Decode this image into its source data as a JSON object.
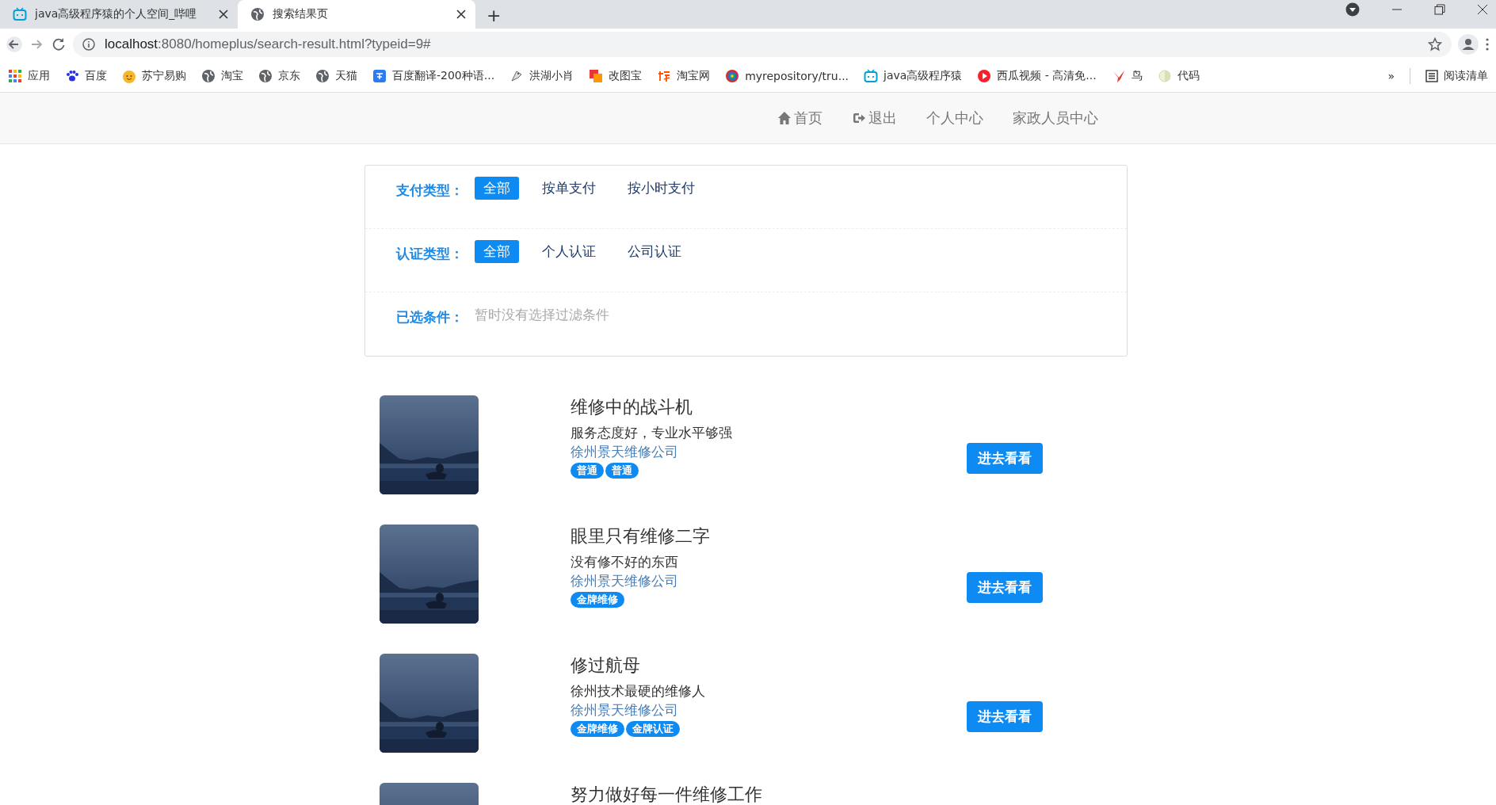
{
  "browser": {
    "tabs": [
      {
        "title": "java高级程序猿的个人空间_哔哩",
        "selected": false,
        "kind": "tv"
      },
      {
        "title": "搜索结果页",
        "selected": true,
        "kind": "globe"
      }
    ],
    "new_tab": "+",
    "url": {
      "host": "localhost",
      "rest": ":8080/homeplus/search-result.html?typeid=9#"
    },
    "bookmarks": [
      {
        "label": "应用",
        "kind": "grid"
      },
      {
        "label": "百度",
        "kind": "paw"
      },
      {
        "label": "苏宁易购",
        "kind": "face"
      },
      {
        "label": "淘宝",
        "kind": "globe"
      },
      {
        "label": "京东",
        "kind": "globe"
      },
      {
        "label": "天猫",
        "kind": "globe"
      },
      {
        "label": "百度翻译-200种语...",
        "kind": "translate"
      },
      {
        "label": "洪湖小肖",
        "kind": "bird"
      },
      {
        "label": "改图宝",
        "kind": "square"
      },
      {
        "label": "淘宝网",
        "kind": "taobao"
      },
      {
        "label": "myrepository/tru...",
        "kind": "ring"
      },
      {
        "label": "java高级程序猿",
        "kind": "tv"
      },
      {
        "label": "西瓜视频 - 高清免...",
        "kind": "play"
      },
      {
        "label": "鸟",
        "kind": "swallow"
      },
      {
        "label": "代码",
        "kind": "moon"
      }
    ],
    "more": "»",
    "reading_list": "阅读清单"
  },
  "nav": [
    {
      "label": "首页",
      "kind": "home"
    },
    {
      "label": "退出",
      "kind": "logout"
    },
    {
      "label": "个人中心",
      "kind": "text"
    },
    {
      "label": "家政人员中心",
      "kind": "text"
    }
  ],
  "filters": [
    {
      "label": "支付类型：",
      "options": [
        {
          "label": "全部",
          "selected": true
        },
        {
          "label": "按单支付",
          "selected": false
        },
        {
          "label": "按小时支付",
          "selected": false
        }
      ]
    },
    {
      "label": "认证类型：",
      "options": [
        {
          "label": "全部",
          "selected": true
        },
        {
          "label": "个人认证",
          "selected": false
        },
        {
          "label": "公司认证",
          "selected": false
        }
      ]
    }
  ],
  "selected_conditions": {
    "label": "已选条件：",
    "text": "暂时没有选择过滤条件"
  },
  "results": [
    {
      "kind": "picture",
      "title": "维修中的战斗机",
      "description": "服务态度好，专业水平够强",
      "company": "徐州景天维修公司",
      "tags": [
        "普通",
        "普通"
      ],
      "button": "进去看看"
    },
    {
      "kind": "picture",
      "title": "眼里只有维修二字",
      "description": "没有修不好的东西",
      "company": "徐州景天维修公司",
      "tags": [
        "金牌维修"
      ],
      "button": "进去看看"
    },
    {
      "kind": "picture",
      "title": "修过航母",
      "description": "徐州技术最硬的维修人",
      "company": "徐州景天维修公司",
      "tags": [
        "金牌维修",
        "金牌认证"
      ],
      "button": "进去看看"
    },
    {
      "kind": "picture",
      "title": "努力做好每一件维修工作"
    }
  ]
}
